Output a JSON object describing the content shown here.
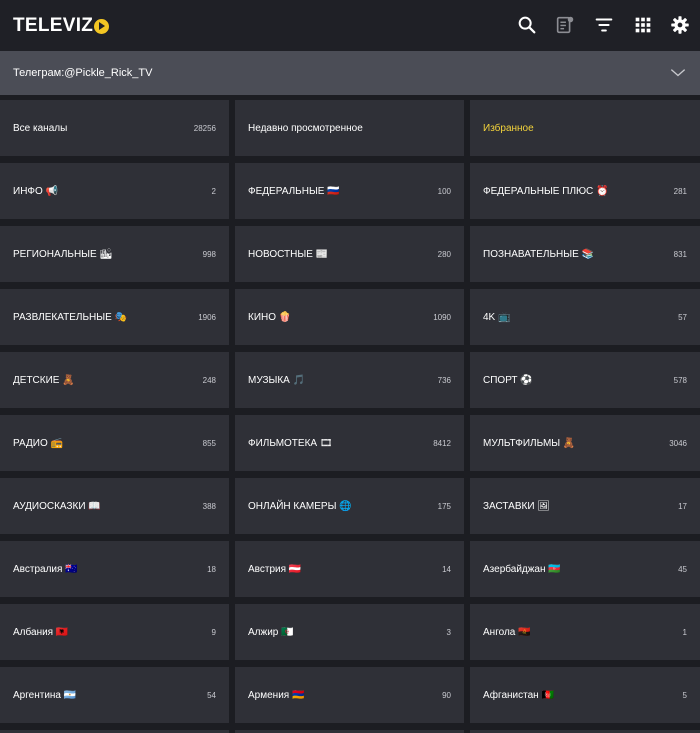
{
  "app": {
    "brand": "TELEVIZ",
    "brand_color": "#f3c623",
    "toolbar_icons": [
      "search-icon",
      "playlist-icon",
      "filter-icon",
      "apps-grid-icon",
      "settings-gear-icon"
    ]
  },
  "banner": {
    "text": "Телеграм:@Pickle_Rick_TV"
  },
  "tiles": [
    {
      "label": "Все каналы",
      "count": "28256"
    },
    {
      "label": "Недавно просмотренное",
      "count": ""
    },
    {
      "label": "Избранное",
      "count": "",
      "highlight": true
    },
    {
      "label": "ИНФО 📢",
      "count": "2"
    },
    {
      "label": "ФЕДЕРАЛЬНЫЕ 🇷🇺",
      "count": "100"
    },
    {
      "label": "ФЕДЕРАЛЬНЫЕ ПЛЮС ⏰",
      "count": "281"
    },
    {
      "label": "РЕГИОНАЛЬНЫЕ 🏙",
      "count": "998"
    },
    {
      "label": "НОВОСТНЫЕ 📰",
      "count": "280"
    },
    {
      "label": "ПОЗНАВАТЕЛЬНЫЕ 📚",
      "count": "831"
    },
    {
      "label": "РАЗВЛЕКАТЕЛЬНЫЕ 🎭",
      "count": "1906"
    },
    {
      "label": "КИНО 🍿",
      "count": "1090"
    },
    {
      "label": "4K 📺",
      "count": "57"
    },
    {
      "label": "ДЕТСКИЕ 🧸",
      "count": "248"
    },
    {
      "label": "МУЗЫКА 🎵",
      "count": "736"
    },
    {
      "label": "СПОРТ ⚽",
      "count": "578"
    },
    {
      "label": "РАДИО 📻",
      "count": "855"
    },
    {
      "label": "ФИЛЬМОТЕКА 🎞",
      "count": "8412"
    },
    {
      "label": "МУЛЬТФИЛЬМЫ 🧸",
      "count": "3046"
    },
    {
      "label": "АУДИОСКАЗКИ 📖",
      "count": "388"
    },
    {
      "label": "ОНЛАЙН КАМЕРЫ 🌐",
      "count": "175"
    },
    {
      "label": "ЗАСТАВКИ 🖼",
      "count": "17"
    },
    {
      "label": "Австралия 🇦🇺",
      "count": "18"
    },
    {
      "label": "Австрия 🇦🇹",
      "count": "14"
    },
    {
      "label": "Азербайджан 🇦🇿",
      "count": "45"
    },
    {
      "label": "Албания 🇦🇱",
      "count": "9"
    },
    {
      "label": "Алжир 🇩🇿",
      "count": "3"
    },
    {
      "label": "Ангола 🇦🇴",
      "count": "1"
    },
    {
      "label": "Аргентина 🇦🇷",
      "count": "54"
    },
    {
      "label": "Армения 🇦🇲",
      "count": "90"
    },
    {
      "label": "Афганистан 🇦🇫",
      "count": "5"
    }
  ]
}
